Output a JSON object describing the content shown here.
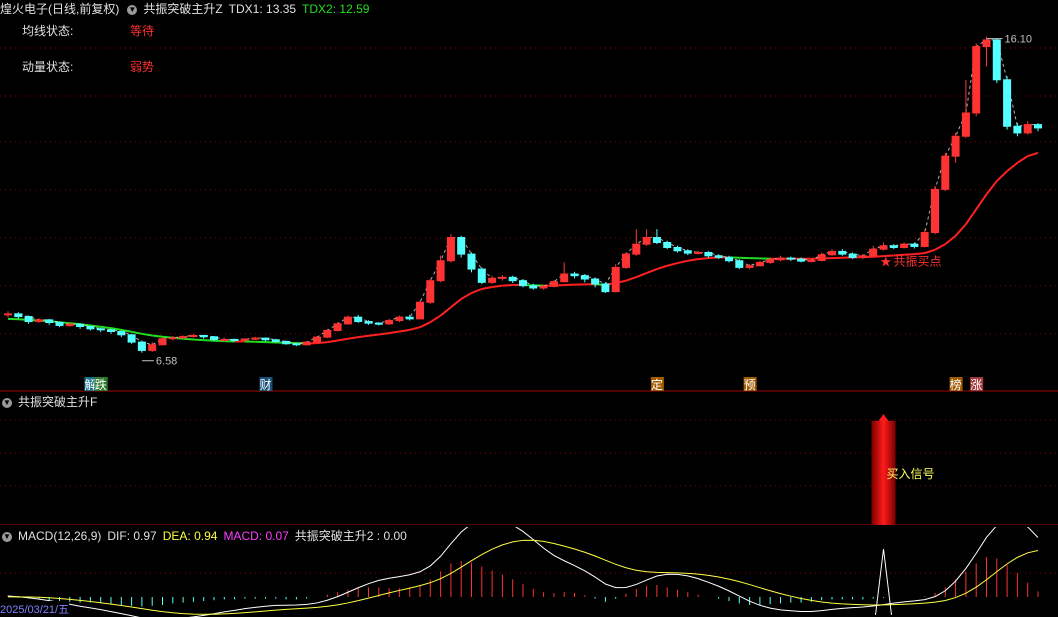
{
  "main": {
    "stock_title": "煌火电子(日线,前复权)",
    "indicator_name": "共振突破主升Z",
    "tdx1_label": "TDX1: 13.35",
    "tdx2_label": "TDX2: 12.59",
    "ma_status_label": "均线状态:",
    "ma_status_value": "等待",
    "momentum_status_label": "动量状态:",
    "momentum_status_value": "弱势",
    "high_price": "16.10",
    "low_price": "6.58",
    "buy_point_label": "共振买点",
    "event_tags": [
      "解",
      "跌",
      "财",
      "定",
      "预",
      "榜",
      "涨"
    ],
    "colors": {
      "up": "#ff3333",
      "down": "#54ffff",
      "ma_up": "#ff2020",
      "ma_down": "#22dd22",
      "tdx2": "#22dd22",
      "grid": "#8b0000"
    }
  },
  "f_panel": {
    "indicator_name": "共振突破主升F",
    "signal_label": "买入信号"
  },
  "macd_panel": {
    "indicator_name": "MACD(12,26,9)",
    "dif_label": "DIF: 0.97",
    "dea_label": "DEA: 0.94",
    "macd_label": "MACD: 0.07",
    "extra_label": "共振突破主升2 : 0.00",
    "date_label": "2025/03/21/五"
  },
  "chart_data": {
    "type": "candlestick",
    "price_range": [
      6.0,
      16.6
    ],
    "candles": [
      [
        7.72,
        7.75,
        7.83,
        7.64
      ],
      [
        7.75,
        7.67,
        7.8,
        7.6
      ],
      [
        7.67,
        7.52,
        7.7,
        7.45
      ],
      [
        7.52,
        7.57,
        7.62,
        7.48
      ],
      [
        7.57,
        7.49,
        7.6,
        7.42
      ],
      [
        7.49,
        7.4,
        7.52,
        7.35
      ],
      [
        7.4,
        7.44,
        7.48,
        7.36
      ],
      [
        7.44,
        7.37,
        7.47,
        7.3
      ],
      [
        7.37,
        7.3,
        7.4,
        7.25
      ],
      [
        7.3,
        7.27,
        7.33,
        7.2
      ],
      [
        7.27,
        7.22,
        7.3,
        7.15
      ],
      [
        7.22,
        7.12,
        7.25,
        7.05
      ],
      [
        7.12,
        6.9,
        7.15,
        6.85
      ],
      [
        6.9,
        6.65,
        6.95,
        6.58
      ],
      [
        6.65,
        6.82,
        6.9,
        6.6
      ],
      [
        6.82,
        7.0,
        7.05,
        6.8
      ],
      [
        7.0,
        7.03,
        7.08,
        6.95
      ],
      [
        7.03,
        7.07,
        7.1,
        7.0
      ],
      [
        7.07,
        7.1,
        7.15,
        7.03
      ],
      [
        7.1,
        7.06,
        7.12,
        7.0
      ],
      [
        7.06,
        6.98,
        7.08,
        6.93
      ],
      [
        6.98,
        6.98,
        7.03,
        6.94
      ],
      [
        6.98,
        6.96,
        7.0,
        6.92
      ],
      [
        6.96,
        6.99,
        7.02,
        6.94
      ],
      [
        6.99,
        7.02,
        7.06,
        6.96
      ],
      [
        7.02,
        6.97,
        7.04,
        6.92
      ],
      [
        6.97,
        6.92,
        7.0,
        6.88
      ],
      [
        6.92,
        6.85,
        6.95,
        6.82
      ],
      [
        6.85,
        6.82,
        6.88,
        6.78
      ],
      [
        6.82,
        6.9,
        6.93,
        6.8
      ],
      [
        6.9,
        7.05,
        7.08,
        6.88
      ],
      [
        7.05,
        7.25,
        7.3,
        7.02
      ],
      [
        7.25,
        7.45,
        7.5,
        7.22
      ],
      [
        7.45,
        7.65,
        7.7,
        7.42
      ],
      [
        7.65,
        7.52,
        7.72,
        7.48
      ],
      [
        7.52,
        7.47,
        7.56,
        7.42
      ],
      [
        7.47,
        7.45,
        7.5,
        7.4
      ],
      [
        7.45,
        7.55,
        7.6,
        7.42
      ],
      [
        7.55,
        7.65,
        7.7,
        7.5
      ],
      [
        7.65,
        7.6,
        7.72,
        7.55
      ],
      [
        7.6,
        8.1,
        8.15,
        7.58
      ],
      [
        8.1,
        8.75,
        8.8,
        8.05
      ],
      [
        8.75,
        9.35,
        9.5,
        8.7
      ],
      [
        9.35,
        10.05,
        10.15,
        9.3
      ],
      [
        10.05,
        9.55,
        10.1,
        9.45
      ],
      [
        9.55,
        9.1,
        9.6,
        9.0
      ],
      [
        9.1,
        8.7,
        9.15,
        8.65
      ],
      [
        8.7,
        8.82,
        8.9,
        8.65
      ],
      [
        8.82,
        8.85,
        8.92,
        8.75
      ],
      [
        8.85,
        8.75,
        8.9,
        8.68
      ],
      [
        8.75,
        8.6,
        8.8,
        8.55
      ],
      [
        8.6,
        8.53,
        8.66,
        8.48
      ],
      [
        8.53,
        8.58,
        8.63,
        8.48
      ],
      [
        8.58,
        8.72,
        8.76,
        8.55
      ],
      [
        8.72,
        8.95,
        9.3,
        8.7
      ],
      [
        8.95,
        8.9,
        9.02,
        8.82
      ],
      [
        8.9,
        8.8,
        8.95,
        8.7
      ],
      [
        8.8,
        8.65,
        8.85,
        8.55
      ],
      [
        8.65,
        8.42,
        8.7,
        8.38
      ],
      [
        8.42,
        9.15,
        9.25,
        8.4
      ],
      [
        9.15,
        9.55,
        9.6,
        9.1
      ],
      [
        9.55,
        9.85,
        10.3,
        9.5
      ],
      [
        9.85,
        10.05,
        10.3,
        9.8
      ],
      [
        10.05,
        9.9,
        10.3,
        9.85
      ],
      [
        9.9,
        9.75,
        9.95,
        9.7
      ],
      [
        9.75,
        9.65,
        9.8,
        9.6
      ],
      [
        9.65,
        9.58,
        9.7,
        9.52
      ],
      [
        9.58,
        9.6,
        9.65,
        9.54
      ],
      [
        9.6,
        9.5,
        9.64,
        9.44
      ],
      [
        9.5,
        9.45,
        9.55,
        9.4
      ],
      [
        9.45,
        9.35,
        9.5,
        9.3
      ],
      [
        9.35,
        9.15,
        9.4,
        9.1
      ],
      [
        9.15,
        9.2,
        9.25,
        9.1
      ],
      [
        9.2,
        9.3,
        9.35,
        9.18
      ],
      [
        9.3,
        9.38,
        9.45,
        9.26
      ],
      [
        9.38,
        9.43,
        9.5,
        9.34
      ],
      [
        9.43,
        9.4,
        9.48,
        9.34
      ],
      [
        9.4,
        9.34,
        9.45,
        9.3
      ],
      [
        9.34,
        9.36,
        9.4,
        9.3
      ],
      [
        9.36,
        9.53,
        9.6,
        9.33
      ],
      [
        9.53,
        9.63,
        9.7,
        9.5
      ],
      [
        9.63,
        9.55,
        9.7,
        9.5
      ],
      [
        9.55,
        9.45,
        9.6,
        9.4
      ],
      [
        9.45,
        9.5,
        9.55,
        9.4
      ],
      [
        9.5,
        9.7,
        9.8,
        9.46
      ],
      [
        9.7,
        9.8,
        9.9,
        9.66
      ],
      [
        9.8,
        9.75,
        9.85,
        9.7
      ],
      [
        9.75,
        9.85,
        9.9,
        9.72
      ],
      [
        9.85,
        9.78,
        9.9,
        9.72
      ],
      [
        9.78,
        10.2,
        10.3,
        9.75
      ],
      [
        10.2,
        11.5,
        11.6,
        10.15
      ],
      [
        11.5,
        12.5,
        12.6,
        11.45
      ],
      [
        12.5,
        13.1,
        13.2,
        12.3
      ],
      [
        13.1,
        13.8,
        14.8,
        13.05
      ],
      [
        13.8,
        15.8,
        15.9,
        13.7
      ],
      [
        15.8,
        16.0,
        16.1,
        15.2
      ],
      [
        16.0,
        14.8,
        16.05,
        14.7
      ],
      [
        14.8,
        13.4,
        14.9,
        13.3
      ],
      [
        13.4,
        13.2,
        13.5,
        13.1
      ],
      [
        13.2,
        13.45,
        13.55,
        13.15
      ],
      [
        13.45,
        13.35,
        13.5,
        13.25
      ]
    ],
    "ma_values": [
      7.6,
      7.59,
      7.57,
      7.55,
      7.53,
      7.5,
      7.47,
      7.44,
      7.4,
      7.36,
      7.32,
      7.27,
      7.21,
      7.15,
      7.1,
      7.06,
      7.03,
      7.0,
      6.98,
      6.96,
      6.94,
      6.93,
      6.92,
      6.92,
      6.91,
      6.9,
      6.89,
      6.88,
      6.87,
      6.86,
      6.87,
      6.9,
      6.95,
      7.0,
      7.05,
      7.09,
      7.13,
      7.17,
      7.22,
      7.27,
      7.35,
      7.5,
      7.7,
      7.95,
      8.2,
      8.38,
      8.5,
      8.56,
      8.6,
      8.62,
      8.62,
      8.61,
      8.6,
      8.6,
      8.62,
      8.63,
      8.64,
      8.64,
      8.63,
      8.68,
      8.75,
      8.86,
      8.98,
      9.1,
      9.2,
      9.28,
      9.35,
      9.4,
      9.43,
      9.45,
      9.45,
      9.44,
      9.43,
      9.42,
      9.41,
      9.41,
      9.41,
      9.41,
      9.41,
      9.42,
      9.43,
      9.44,
      9.45,
      9.46,
      9.47,
      9.49,
      9.51,
      9.53,
      9.55,
      9.58,
      9.68,
      9.85,
      10.1,
      10.45,
      10.9,
      11.35,
      11.75,
      12.05,
      12.3,
      12.5,
      12.6
    ],
    "macd_bars": [
      0.02,
      -0.01,
      -0.02,
      -0.03,
      -0.04,
      -0.05,
      -0.06,
      -0.07,
      -0.07,
      -0.08,
      -0.09,
      -0.1,
      -0.11,
      -0.12,
      -0.11,
      -0.1,
      -0.08,
      -0.07,
      -0.06,
      -0.05,
      -0.04,
      -0.03,
      -0.03,
      -0.02,
      -0.02,
      -0.02,
      -0.02,
      -0.03,
      -0.03,
      -0.02,
      0.0,
      0.03,
      0.06,
      0.09,
      0.11,
      0.12,
      0.12,
      0.11,
      0.11,
      0.12,
      0.15,
      0.22,
      0.32,
      0.42,
      0.45,
      0.43,
      0.38,
      0.33,
      0.28,
      0.22,
      0.16,
      0.1,
      0.06,
      0.05,
      0.06,
      0.05,
      0.02,
      -0.02,
      -0.06,
      -0.02,
      0.04,
      0.1,
      0.14,
      0.15,
      0.12,
      0.09,
      0.06,
      0.03,
      0.0,
      -0.02,
      -0.05,
      -0.08,
      -0.1,
      -0.1,
      -0.09,
      -0.08,
      -0.07,
      -0.07,
      -0.06,
      -0.04,
      -0.03,
      -0.03,
      -0.03,
      -0.03,
      -0.02,
      -0.01,
      0.0,
      0.0,
      0.0,
      0.01,
      0.05,
      0.12,
      0.22,
      0.32,
      0.42,
      0.5,
      0.48,
      0.4,
      0.3,
      0.18,
      0.07
    ]
  }
}
